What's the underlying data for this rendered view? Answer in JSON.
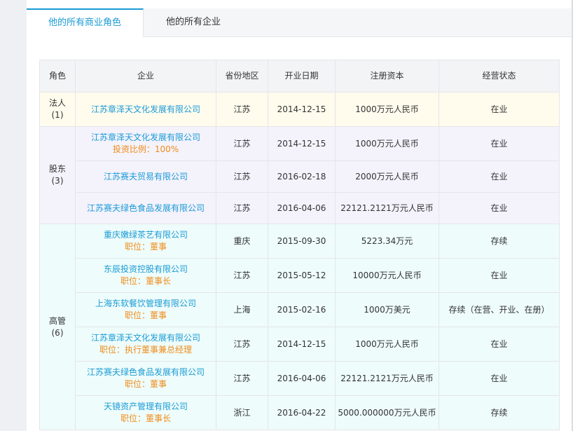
{
  "tabs": [
    {
      "label": "他的所有商业角色",
      "active": true
    },
    {
      "label": "他的所有企业",
      "active": false
    }
  ],
  "table": {
    "headers": [
      "角色",
      "企业",
      "省份地区",
      "开业日期",
      "注册资本",
      "经营状态"
    ],
    "groups": [
      {
        "role": "法人",
        "count": "(1)",
        "rows": [
          {
            "company": "江苏章泽天文化发展有限公司",
            "sub": "",
            "province": "江苏",
            "date": "2014-12-15",
            "capital": "1000万元人民币",
            "status": "在业"
          }
        ]
      },
      {
        "role": "股东",
        "count": "(3)",
        "rows": [
          {
            "company": "江苏章泽天文化发展有限公司",
            "sub": "投资比例：100%",
            "province": "江苏",
            "date": "2014-12-15",
            "capital": "1000万元人民币",
            "status": "在业"
          },
          {
            "company": "江苏赛夫贸易有限公司",
            "sub": "",
            "province": "江苏",
            "date": "2016-02-18",
            "capital": "2000万元人民币",
            "status": "在业"
          },
          {
            "company": "江苏赛夫绿色食品发展有限公司",
            "sub": "",
            "province": "江苏",
            "date": "2016-04-06",
            "capital": "22121.2121万元人民币",
            "status": "在业"
          }
        ]
      },
      {
        "role": "高管",
        "count": "(6)",
        "rows": [
          {
            "company": "重庆嫩绿茶艺有限公司",
            "sub": "职位：董事",
            "province": "重庆",
            "date": "2015-09-30",
            "capital": "5223.34万元",
            "status": "存续"
          },
          {
            "company": "东辰投资控股有限公司",
            "sub": "职位：董事长",
            "province": "江苏",
            "date": "2015-05-12",
            "capital": "10000万元人民币",
            "status": "在业"
          },
          {
            "company": "上海东软餐饮管理有限公司",
            "sub": "职位：董事",
            "province": "上海",
            "date": "2015-02-16",
            "capital": "1000万美元",
            "status": "存续（在营、开业、在册）"
          },
          {
            "company": "江苏章泽天文化发展有限公司",
            "sub": "职位：执行董事兼总经理",
            "province": "江苏",
            "date": "2014-12-15",
            "capital": "1000万元人民币",
            "status": "在业"
          },
          {
            "company": "江苏赛夫绿色食品发展有限公司",
            "sub": "职位：董事",
            "province": "江苏",
            "date": "2016-04-06",
            "capital": "22121.2121万元人民币",
            "status": "在业"
          },
          {
            "company": "天镜资产管理有限公司",
            "sub": "职位：董事长",
            "province": "浙江",
            "date": "2016-04-22",
            "capital": "5000.000000万元人民币",
            "status": "存续"
          }
        ]
      }
    ]
  },
  "colors": {
    "accent": "#1a9bd6",
    "subtext": "#f08c1a",
    "legal_bg": "#fffbed",
    "share_bg": "#f4f2fb",
    "exec_bg": "#eefcfb"
  }
}
